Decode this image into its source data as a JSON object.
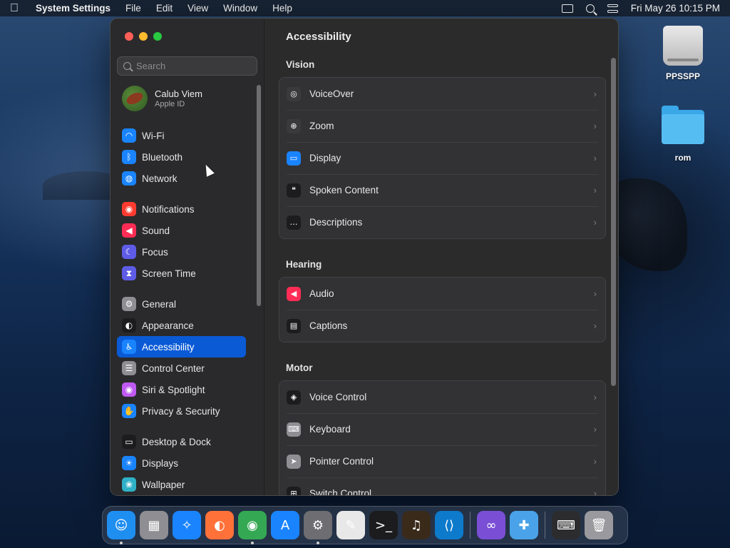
{
  "menubar": {
    "app_name": "System Settings",
    "menus": [
      "File",
      "Edit",
      "View",
      "Window",
      "Help"
    ],
    "datetime": "Fri May 26  10:15 PM"
  },
  "desktop": {
    "icons": [
      {
        "label": "PPSSPP",
        "type": "drive-icon"
      },
      {
        "label": "rom",
        "type": "folder-icon"
      }
    ]
  },
  "sidebar": {
    "search_placeholder": "Search",
    "profile": {
      "name": "Calub Viem",
      "subtitle": "Apple ID"
    },
    "groups": [
      [
        {
          "label": "Wi-Fi",
          "icon": "wifi-icon",
          "color": "#1a84ff",
          "glyph": "◠"
        },
        {
          "label": "Bluetooth",
          "icon": "bluetooth-icon",
          "color": "#1a84ff",
          "glyph": "ᛒ"
        },
        {
          "label": "Network",
          "icon": "globe-icon",
          "color": "#1a84ff",
          "glyph": "◍"
        }
      ],
      [
        {
          "label": "Notifications",
          "icon": "bell-icon",
          "color": "#ff3b30",
          "glyph": "◉"
        },
        {
          "label": "Sound",
          "icon": "speaker-icon",
          "color": "#ff2d55",
          "glyph": "◀"
        },
        {
          "label": "Focus",
          "icon": "moon-icon",
          "color": "#5e5ce6",
          "glyph": "☾"
        },
        {
          "label": "Screen Time",
          "icon": "hourglass-icon",
          "color": "#5e5ce6",
          "glyph": "⧗"
        }
      ],
      [
        {
          "label": "General",
          "icon": "gear-icon",
          "color": "#8e8e93",
          "glyph": "⚙"
        },
        {
          "label": "Appearance",
          "icon": "appearance-icon",
          "color": "#1c1c1e",
          "glyph": "◐"
        },
        {
          "label": "Accessibility",
          "icon": "accessibility-icon",
          "color": "#1a84ff",
          "glyph": "♿",
          "active": true
        },
        {
          "label": "Control Center",
          "icon": "control-center-icon",
          "color": "#8e8e93",
          "glyph": "☰"
        },
        {
          "label": "Siri & Spotlight",
          "icon": "siri-icon",
          "color": "#bf5af2",
          "glyph": "◉"
        },
        {
          "label": "Privacy & Security",
          "icon": "hand-icon",
          "color": "#1a84ff",
          "glyph": "✋"
        }
      ],
      [
        {
          "label": "Desktop & Dock",
          "icon": "dock-icon",
          "color": "#1c1c1e",
          "glyph": "▭"
        },
        {
          "label": "Displays",
          "icon": "displays-icon",
          "color": "#1a84ff",
          "glyph": "☀"
        },
        {
          "label": "Wallpaper",
          "icon": "wallpaper-icon",
          "color": "#30b0c7",
          "glyph": "❀"
        }
      ]
    ]
  },
  "content": {
    "title": "Accessibility",
    "sections": [
      {
        "title": "Vision",
        "rows": [
          {
            "label": "VoiceOver",
            "icon": "voiceover-icon",
            "color": "#3a3a3c",
            "glyph": "◎"
          },
          {
            "label": "Zoom",
            "icon": "zoom-icon",
            "color": "#3a3a3c",
            "glyph": "⊕"
          },
          {
            "label": "Display",
            "icon": "display-icon",
            "color": "#1a84ff",
            "glyph": "▭"
          },
          {
            "label": "Spoken Content",
            "icon": "spoken-content-icon",
            "color": "#1c1c1e",
            "glyph": "❝"
          },
          {
            "label": "Descriptions",
            "icon": "descriptions-icon",
            "color": "#1c1c1e",
            "glyph": "…"
          }
        ]
      },
      {
        "title": "Hearing",
        "rows": [
          {
            "label": "Audio",
            "icon": "audio-icon",
            "color": "#ff2d55",
            "glyph": "◀"
          },
          {
            "label": "Captions",
            "icon": "captions-icon",
            "color": "#1c1c1e",
            "glyph": "▤"
          }
        ]
      },
      {
        "title": "Motor",
        "rows": [
          {
            "label": "Voice Control",
            "icon": "voice-control-icon",
            "color": "#1c1c1e",
            "glyph": "◈"
          },
          {
            "label": "Keyboard",
            "icon": "keyboard-icon",
            "color": "#8e8e93",
            "glyph": "⌨"
          },
          {
            "label": "Pointer Control",
            "icon": "pointer-icon",
            "color": "#8e8e93",
            "glyph": "➤"
          },
          {
            "label": "Switch Control",
            "icon": "switch-control-icon",
            "color": "#1c1c1e",
            "glyph": "⊞"
          }
        ]
      }
    ]
  },
  "dock": {
    "apps": [
      {
        "name": "finder-icon",
        "color": "#1f8ef1",
        "glyph": "☺",
        "running": true
      },
      {
        "name": "launchpad-icon",
        "color": "#8e8e93",
        "glyph": "▦",
        "running": false
      },
      {
        "name": "safari-icon",
        "color": "#1a84ff",
        "glyph": "✧",
        "running": false
      },
      {
        "name": "firefox-icon",
        "color": "#ff7139",
        "glyph": "◐",
        "running": false
      },
      {
        "name": "chrome-icon",
        "color": "#34a853",
        "glyph": "◉",
        "running": true
      },
      {
        "name": "app-store-icon",
        "color": "#1a84ff",
        "glyph": "A",
        "running": false
      },
      {
        "name": "system-settings-icon",
        "color": "#6d6d72",
        "glyph": "⚙",
        "running": true
      },
      {
        "name": "textedit-icon",
        "color": "#e8e8e8",
        "glyph": "✎",
        "running": false
      },
      {
        "name": "terminal-icon",
        "color": "#1c1c1e",
        "glyph": ">_",
        "running": false
      },
      {
        "name": "garageband-icon",
        "color": "#3a2a1a",
        "glyph": "♫",
        "running": false
      },
      {
        "name": "vscode-icon",
        "color": "#0d7acc",
        "glyph": "⟨⟩",
        "running": false
      },
      {
        "name": "visual-studio-icon",
        "color": "#7a4fd6",
        "glyph": "∞",
        "running": false
      },
      {
        "name": "ppsspp-icon",
        "color": "#4aa3e8",
        "glyph": "✚",
        "running": false
      },
      {
        "name": "keyboard-viewer-icon",
        "color": "#2c2c2e",
        "glyph": "⌨",
        "running": false
      },
      {
        "name": "trash-icon",
        "color": "#9a9a9e",
        "glyph": "🗑",
        "running": false
      }
    ]
  }
}
